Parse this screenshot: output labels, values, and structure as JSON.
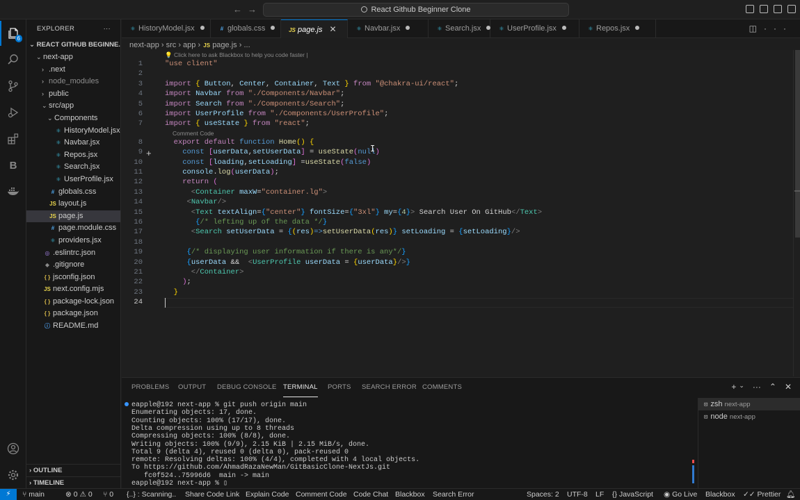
{
  "titlebar": {
    "command_center": "React Github Beginner Clone"
  },
  "activity": {
    "explorer_badge": "6"
  },
  "sidebar": {
    "header": "EXPLORER",
    "more": "···",
    "root": "REACT GITHUB BEGINNE...",
    "items": [
      {
        "label": "next-app",
        "chev": "⌄",
        "indent": 14,
        "icon": ""
      },
      {
        "label": ".next",
        "chev": "›",
        "indent": 22,
        "icon": ""
      },
      {
        "label": "node_modules",
        "chev": "›",
        "indent": 22,
        "icon": "",
        "dim": true
      },
      {
        "label": "public",
        "chev": "›",
        "indent": 22,
        "icon": ""
      },
      {
        "label": "src/app",
        "chev": "⌄",
        "indent": 22,
        "icon": ""
      },
      {
        "label": "Components",
        "chev": "⌄",
        "indent": 30,
        "icon": ""
      },
      {
        "label": "HistoryModel.jsx",
        "indent": 40,
        "icon": "jsx"
      },
      {
        "label": "Navbar.jsx",
        "indent": 40,
        "icon": "jsx"
      },
      {
        "label": "Repos.jsx",
        "indent": 40,
        "icon": "jsx"
      },
      {
        "label": "Search.jsx",
        "indent": 40,
        "icon": "jsx"
      },
      {
        "label": "UserProfile.jsx",
        "indent": 40,
        "icon": "jsx"
      },
      {
        "label": "globals.css",
        "indent": 32,
        "icon": "css"
      },
      {
        "label": "layout.js",
        "indent": 32,
        "icon": "js"
      },
      {
        "label": "page.js",
        "indent": 32,
        "icon": "js"
      },
      {
        "label": "page.module.css",
        "indent": 32,
        "icon": "css"
      },
      {
        "label": "providers.jsx",
        "indent": 32,
        "icon": "jsx"
      },
      {
        "label": ".eslintrc.json",
        "indent": 24,
        "icon": "eslint"
      },
      {
        "label": ".gitignore",
        "indent": 24,
        "icon": "git"
      },
      {
        "label": "jsconfig.json",
        "indent": 24,
        "icon": "json"
      },
      {
        "label": "next.config.mjs",
        "indent": 24,
        "icon": "js"
      },
      {
        "label": "package-lock.json",
        "indent": 24,
        "icon": "json"
      },
      {
        "label": "package.json",
        "indent": 24,
        "icon": "json"
      },
      {
        "label": "README.md",
        "indent": 24,
        "icon": "md"
      }
    ],
    "outline": "OUTLINE",
    "timeline": "TIMELINE"
  },
  "icons": {
    "jsx": "⚛",
    "js": "JS",
    "css": "#",
    "json": "{ }",
    "md": "ⓘ",
    "git": "◆",
    "eslint": "◎"
  },
  "tabs": [
    {
      "label": "HistoryModel.jsx",
      "icon": "jsx",
      "modified": true
    },
    {
      "label": "globals.css",
      "icon": "css",
      "modified": true
    },
    {
      "label": "page.js",
      "icon": "js",
      "active": true
    },
    {
      "label": "Navbar.jsx",
      "icon": "jsx",
      "modified": true
    },
    {
      "label": "Search.jsx",
      "icon": "jsx",
      "modified": true
    },
    {
      "label": "UserProfile.jsx",
      "icon": "jsx",
      "modified": true
    },
    {
      "label": "Repos.jsx",
      "icon": "jsx",
      "modified": true
    }
  ],
  "breadcrumb": {
    "parts": [
      "next-app",
      "src",
      "app",
      "page.js",
      "..."
    ],
    "file_icon": "JS"
  },
  "editor": {
    "hint": "💡 Click here to ask Blackbox to help you code faster |",
    "codelens": "Comment Code",
    "current_line": 24,
    "lines": [
      [
        [
          "\"use client\"",
          "s"
        ]
      ],
      [],
      [
        [
          "import ",
          "k"
        ],
        [
          "{ ",
          "br1"
        ],
        [
          "Button",
          "v"
        ],
        [
          ", ",
          "p"
        ],
        [
          "Center",
          "v"
        ],
        [
          ", ",
          "p"
        ],
        [
          "Container",
          "v"
        ],
        [
          ", ",
          "p"
        ],
        [
          "Text",
          "v"
        ],
        [
          " }",
          "br1"
        ],
        [
          " from ",
          "k"
        ],
        [
          "\"@chakra-ui/react\"",
          "s"
        ],
        [
          ";",
          "p"
        ]
      ],
      [
        [
          "import ",
          "k"
        ],
        [
          "Navbar",
          "v"
        ],
        [
          " from ",
          "k"
        ],
        [
          "\"./Components/Navbar\"",
          "s"
        ],
        [
          ";",
          "p"
        ]
      ],
      [
        [
          "import ",
          "k"
        ],
        [
          "Search",
          "v"
        ],
        [
          " from ",
          "k"
        ],
        [
          "\"./Components/Search\"",
          "s"
        ],
        [
          ";",
          "p"
        ]
      ],
      [
        [
          "import ",
          "k"
        ],
        [
          "UserProfile",
          "v"
        ],
        [
          " from ",
          "k"
        ],
        [
          "\"./Components/UserProfile\"",
          "s"
        ],
        [
          ";",
          "p"
        ]
      ],
      [
        [
          "import ",
          "k"
        ],
        [
          "{ ",
          "br1"
        ],
        [
          "useState",
          "v"
        ],
        [
          " }",
          "br1"
        ],
        [
          " from ",
          "k"
        ],
        [
          "\"react\"",
          "s"
        ],
        [
          ";",
          "p"
        ]
      ],
      [
        [
          "  export ",
          "k"
        ],
        [
          "default ",
          "k"
        ],
        [
          "function ",
          "kb"
        ],
        [
          "Home",
          "f"
        ],
        [
          "()",
          "br1"
        ],
        [
          " {",
          "br1"
        ]
      ],
      [
        [
          "    const ",
          "kb"
        ],
        [
          "[",
          "br2"
        ],
        [
          "userData",
          "v"
        ],
        [
          ",",
          "p"
        ],
        [
          "setUserData",
          "v"
        ],
        [
          "]",
          "br2"
        ],
        [
          " = ",
          "p"
        ],
        [
          "useState",
          "f"
        ],
        [
          "(",
          "br2"
        ],
        [
          "null",
          "kb"
        ],
        [
          ")",
          "br2"
        ]
      ],
      [
        [
          "    const ",
          "kb"
        ],
        [
          "[",
          "br2"
        ],
        [
          "loading",
          "v"
        ],
        [
          ",",
          "p"
        ],
        [
          "setLoading",
          "v"
        ],
        [
          "]",
          "br2"
        ],
        [
          " =",
          "p"
        ],
        [
          "useState",
          "f"
        ],
        [
          "(",
          "br2"
        ],
        [
          "false",
          "kb"
        ],
        [
          ")",
          "br2"
        ]
      ],
      [
        [
          "    console",
          "v"
        ],
        [
          ".",
          "p"
        ],
        [
          "log",
          "f"
        ],
        [
          "(",
          "br2"
        ],
        [
          "userData",
          "v"
        ],
        [
          ")",
          "br2"
        ],
        [
          ";",
          "p"
        ]
      ],
      [
        [
          "    return ",
          "k"
        ],
        [
          "(",
          "br2"
        ]
      ],
      [
        [
          "      <",
          "tg"
        ],
        [
          "Container ",
          "t"
        ],
        [
          "maxW",
          "v"
        ],
        [
          "=",
          "p"
        ],
        [
          "\"container.lg\"",
          "s"
        ],
        [
          ">",
          "tg"
        ]
      ],
      [
        [
          "     <",
          "tg"
        ],
        [
          "Navbar",
          "t"
        ],
        [
          "/>",
          "tg"
        ]
      ],
      [
        [
          "      <",
          "tg"
        ],
        [
          "Text ",
          "t"
        ],
        [
          "textAlign",
          "v"
        ],
        [
          "=",
          "p"
        ],
        [
          "{",
          "br3"
        ],
        [
          "\"center\"",
          "s"
        ],
        [
          "}",
          "br3"
        ],
        [
          " fontSize",
          "v"
        ],
        [
          "=",
          "p"
        ],
        [
          "{",
          "br3"
        ],
        [
          "\"3xl\"",
          "s"
        ],
        [
          "}",
          "br3"
        ],
        [
          " my",
          "v"
        ],
        [
          "=",
          "p"
        ],
        [
          "{",
          "br3"
        ],
        [
          "4",
          "n"
        ],
        [
          "}",
          "br3"
        ],
        [
          "> ",
          "tg"
        ],
        [
          "Search User On GitHub",
          "p"
        ],
        [
          "</",
          "tg"
        ],
        [
          "Text",
          "t"
        ],
        [
          ">",
          "tg"
        ]
      ],
      [
        [
          "       {",
          "br3"
        ],
        [
          "/* lefting up of the data */",
          "c"
        ],
        [
          "}",
          "br3"
        ]
      ],
      [
        [
          "      <",
          "tg"
        ],
        [
          "Search ",
          "t"
        ],
        [
          "setUserData",
          "v"
        ],
        [
          " = ",
          "p"
        ],
        [
          "{",
          "br3"
        ],
        [
          "(",
          "br1"
        ],
        [
          "res",
          "v"
        ],
        [
          ")",
          "br1"
        ],
        [
          "=>",
          "kb"
        ],
        [
          "setUserData",
          "f"
        ],
        [
          "(",
          "br1"
        ],
        [
          "res",
          "v"
        ],
        [
          ")",
          "br1"
        ],
        [
          "}",
          "br3"
        ],
        [
          " setLoading",
          "v"
        ],
        [
          " = ",
          "p"
        ],
        [
          "{",
          "br3"
        ],
        [
          "setLoading",
          "v"
        ],
        [
          "}",
          "br3"
        ],
        [
          "/>",
          "tg"
        ]
      ],
      [],
      [
        [
          "     {",
          "br3"
        ],
        [
          "/* displaying user information if there is any*/",
          "c"
        ],
        [
          "}",
          "br3"
        ]
      ],
      [
        [
          "     {",
          "br3"
        ],
        [
          "userData",
          "v"
        ],
        [
          " &&  ",
          "p"
        ],
        [
          "<",
          "tg"
        ],
        [
          "UserProfile ",
          "t"
        ],
        [
          "userData",
          "v"
        ],
        [
          " = ",
          "p"
        ],
        [
          "{",
          "br1"
        ],
        [
          "userData",
          "v"
        ],
        [
          "}",
          "br1"
        ],
        [
          "/>",
          "tg"
        ],
        [
          "}",
          "br3"
        ]
      ],
      [
        [
          "      </",
          "tg"
        ],
        [
          "Container",
          "t"
        ],
        [
          ">",
          "tg"
        ]
      ],
      [
        [
          "    )",
          "br2"
        ],
        [
          ";",
          "p"
        ]
      ],
      [
        [
          "  }",
          "br1"
        ]
      ],
      []
    ]
  },
  "panel": {
    "tabs": [
      "PROBLEMS",
      "OUTPUT",
      "DEBUG CONSOLE",
      "TERMINAL",
      "PORTS",
      "SEARCH ERROR",
      "COMMENTS"
    ],
    "active_tab": "TERMINAL",
    "terminal_lines": [
      "eapple@192 next-app % git push origin main",
      "Enumerating objects: 17, done.",
      "Counting objects: 100% (17/17), done.",
      "Delta compression using up to 8 threads",
      "Compressing objects: 100% (8/8), done.",
      "Writing objects: 100% (9/9), 2.15 KiB | 2.15 MiB/s, done.",
      "Total 9 (delta 4), reused 0 (delta 0), pack-reused 0",
      "remote: Resolving deltas: 100% (4/4), completed with 4 local objects.",
      "To https://github.com/AhmadRazaNewMan/GitBasicClone-NextJs.git",
      "   fc0f524..75996d6  main -> main",
      "eapple@192 next-app % ▯"
    ],
    "terminals": [
      {
        "name": "zsh",
        "cwd": "next-app",
        "selected": true
      },
      {
        "name": "node",
        "cwd": "next-app"
      }
    ]
  },
  "status": {
    "branch": "main",
    "errors": "0",
    "warnings": "0",
    "ports": "0",
    "scanning": "{..} : Scanning..",
    "items": [
      "Share Code Link",
      "Explain Code",
      "Comment Code",
      "Code Chat",
      "Blackbox",
      "Search Error"
    ],
    "spaces": "Spaces: 2",
    "encoding": "UTF-8",
    "eol": "LF",
    "language": "JavaScript",
    "golive": "Go Live",
    "blackbox": "Blackbox",
    "prettier": "Prettier"
  }
}
